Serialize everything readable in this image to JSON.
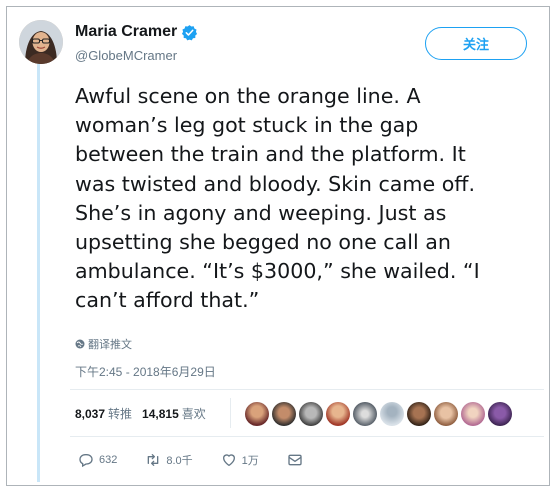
{
  "user": {
    "name": "Maria Cramer",
    "handle": "@GlobeMCramer",
    "verified_icon": "verified-badge-icon",
    "avatar_icon": "avatar"
  },
  "follow_button": {
    "label": "关注"
  },
  "tweet": {
    "text": "Awful scene on the orange line. A\nwoman’s leg got stuck in the gap\nbetween the train and the platform. It\nwas twisted and bloody. Skin came off.\nShe’s in agony and weeping. Just as\nupsetting she begged no one call an\nambulance. “It’s $3000,” she wailed. “I\ncan’t afford that.”",
    "translate_label": "翻译推文",
    "timestamp": "下午2:45 - 2018年6月29日"
  },
  "stats": {
    "retweets_count": "8,037",
    "retweets_label": "转推",
    "likes_count": "14,815",
    "likes_label": "喜欢",
    "liker_avatars": 10
  },
  "actions": {
    "reply_count": "632",
    "retweet_count": "8.0千",
    "like_count": "1万"
  },
  "colors": {
    "accent": "#1da1f2",
    "muted": "#657786",
    "text": "#14171a",
    "thread_line": "#c9e6f8"
  }
}
